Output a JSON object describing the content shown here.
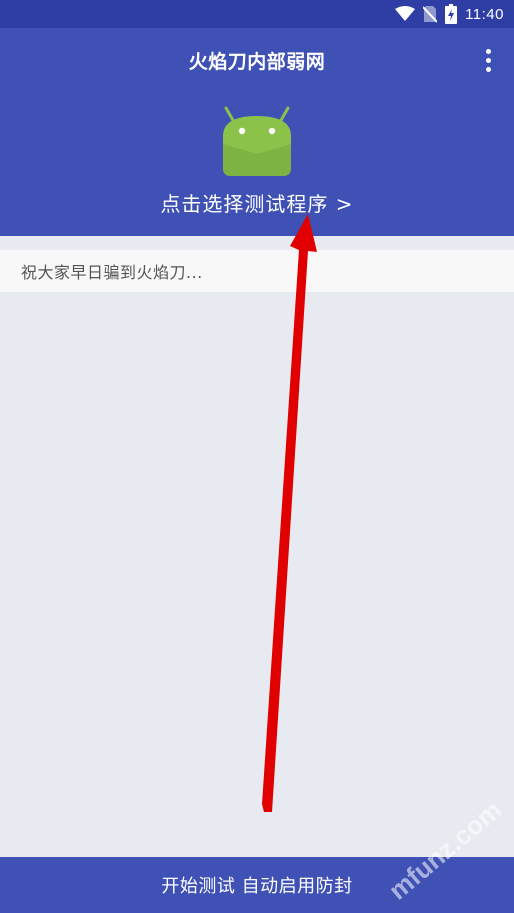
{
  "status_bar": {
    "time": "11:40",
    "icons": [
      "wifi-icon",
      "no-sim-icon",
      "battery-charging-icon"
    ]
  },
  "app_bar": {
    "title": "火焰刀内部弱网",
    "menu_icon": "overflow-menu-icon"
  },
  "header": {
    "logo_icon": "android-icon",
    "select_label": "点击选择测试程序 >"
  },
  "notice": {
    "text": "祝大家早日骗到火焰刀..."
  },
  "bottom": {
    "start_label": "开始测试 自动启用防封"
  },
  "watermark": {
    "text": "mfunz.com"
  },
  "colors": {
    "status_bar": "#2f3ea5",
    "primary": "#3f51b5",
    "background": "#e8eaf1",
    "android_green": "#8bc34a",
    "arrow_red": "#e00000"
  }
}
